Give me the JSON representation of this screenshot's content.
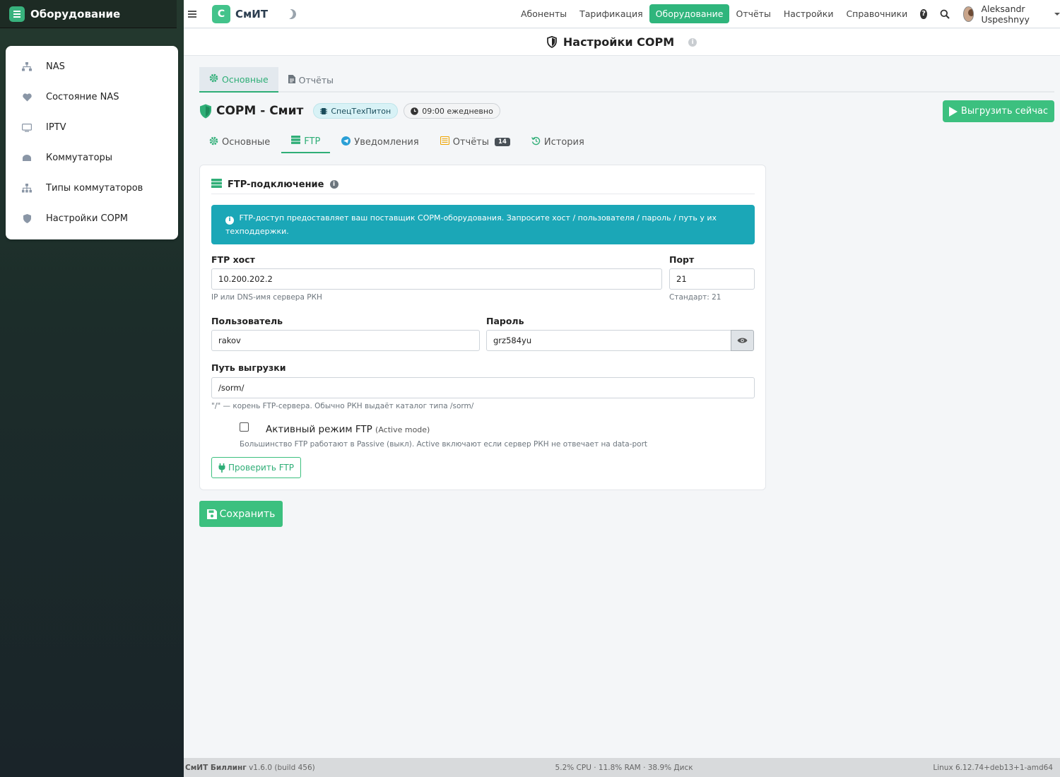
{
  "sidebar": {
    "title": "Оборудование",
    "items": [
      {
        "label": "NAS",
        "icon": "network-icon"
      },
      {
        "label": "Состояние NAS",
        "icon": "heartbeat-icon"
      },
      {
        "label": "IPTV",
        "icon": "tv-icon"
      },
      {
        "label": "Коммутаторы",
        "icon": "switch-icon"
      },
      {
        "label": "Типы коммутаторов",
        "icon": "sitemap-icon"
      },
      {
        "label": "Настройки СОРМ",
        "icon": "shield-icon"
      }
    ]
  },
  "topnav": {
    "logo_letter": "С",
    "logo_text": "СмИТ",
    "links": [
      "Абоненты",
      "Тарификация",
      "Оборудование",
      "Отчёты",
      "Настройки",
      "Справочники"
    ],
    "active_link": "Оборудование",
    "user": "Aleksandr Uspeshnyy",
    "accent": "#2fb57c"
  },
  "page": {
    "title": "Настройки СОРМ"
  },
  "top_tabs": [
    {
      "label": "Основные",
      "active": true
    },
    {
      "label": "Отчёты",
      "active": false
    }
  ],
  "header": {
    "title": "СОРМ - Смит",
    "vendor_badge": "СпецТехПитон",
    "schedule_badge": "09:00 ежедневно",
    "export_button": "Выгрузить сейчас"
  },
  "sub_tabs": [
    {
      "label": "Основные"
    },
    {
      "label": "FTP",
      "active": true
    },
    {
      "label": "Уведомления"
    },
    {
      "label": "Отчёты",
      "count": "14"
    },
    {
      "label": "История"
    }
  ],
  "ftp": {
    "card_title": "FTP-подключение",
    "alert_line1": "FTP-доступ предоставляет ваш поставщик СОРМ-оборудования. Запросите хост / пользователя / пароль / путь у их",
    "alert_line2": "техподдержки.",
    "host_label": "FTP хост",
    "host_value": "10.200.202.2",
    "host_hint": "IP или DNS-имя сервера РКН",
    "port_label": "Порт",
    "port_value": "21",
    "port_hint": "Стандарт: 21",
    "user_label": "Пользователь",
    "user_value": "rakov",
    "password_label": "Пароль",
    "password_value": "grz584yu",
    "path_label": "Путь выгрузки",
    "path_value": "/sorm/",
    "path_hint": "\"/\" — корень FTP-сервера. Обычно РКН выдаёт каталог типа /sorm/",
    "active_mode_label": "Активный режим FTP",
    "active_mode_sub": "(Active mode)",
    "active_mode_checked": false,
    "active_mode_hint": "Большинство FTP работают в Passive (выкл). Active включают если сервер РКН не отвечает на data-port",
    "check_button": "Проверить FTP"
  },
  "save_button": "Сохранить",
  "footer": {
    "app": "СмИТ Биллинг",
    "version": "v1.6.0 (build 456)",
    "stats": "5.2% CPU · 11.8% RAM · 38.9% Диск",
    "kernel": "Linux 6.12.74+deb13+1-amd64"
  }
}
